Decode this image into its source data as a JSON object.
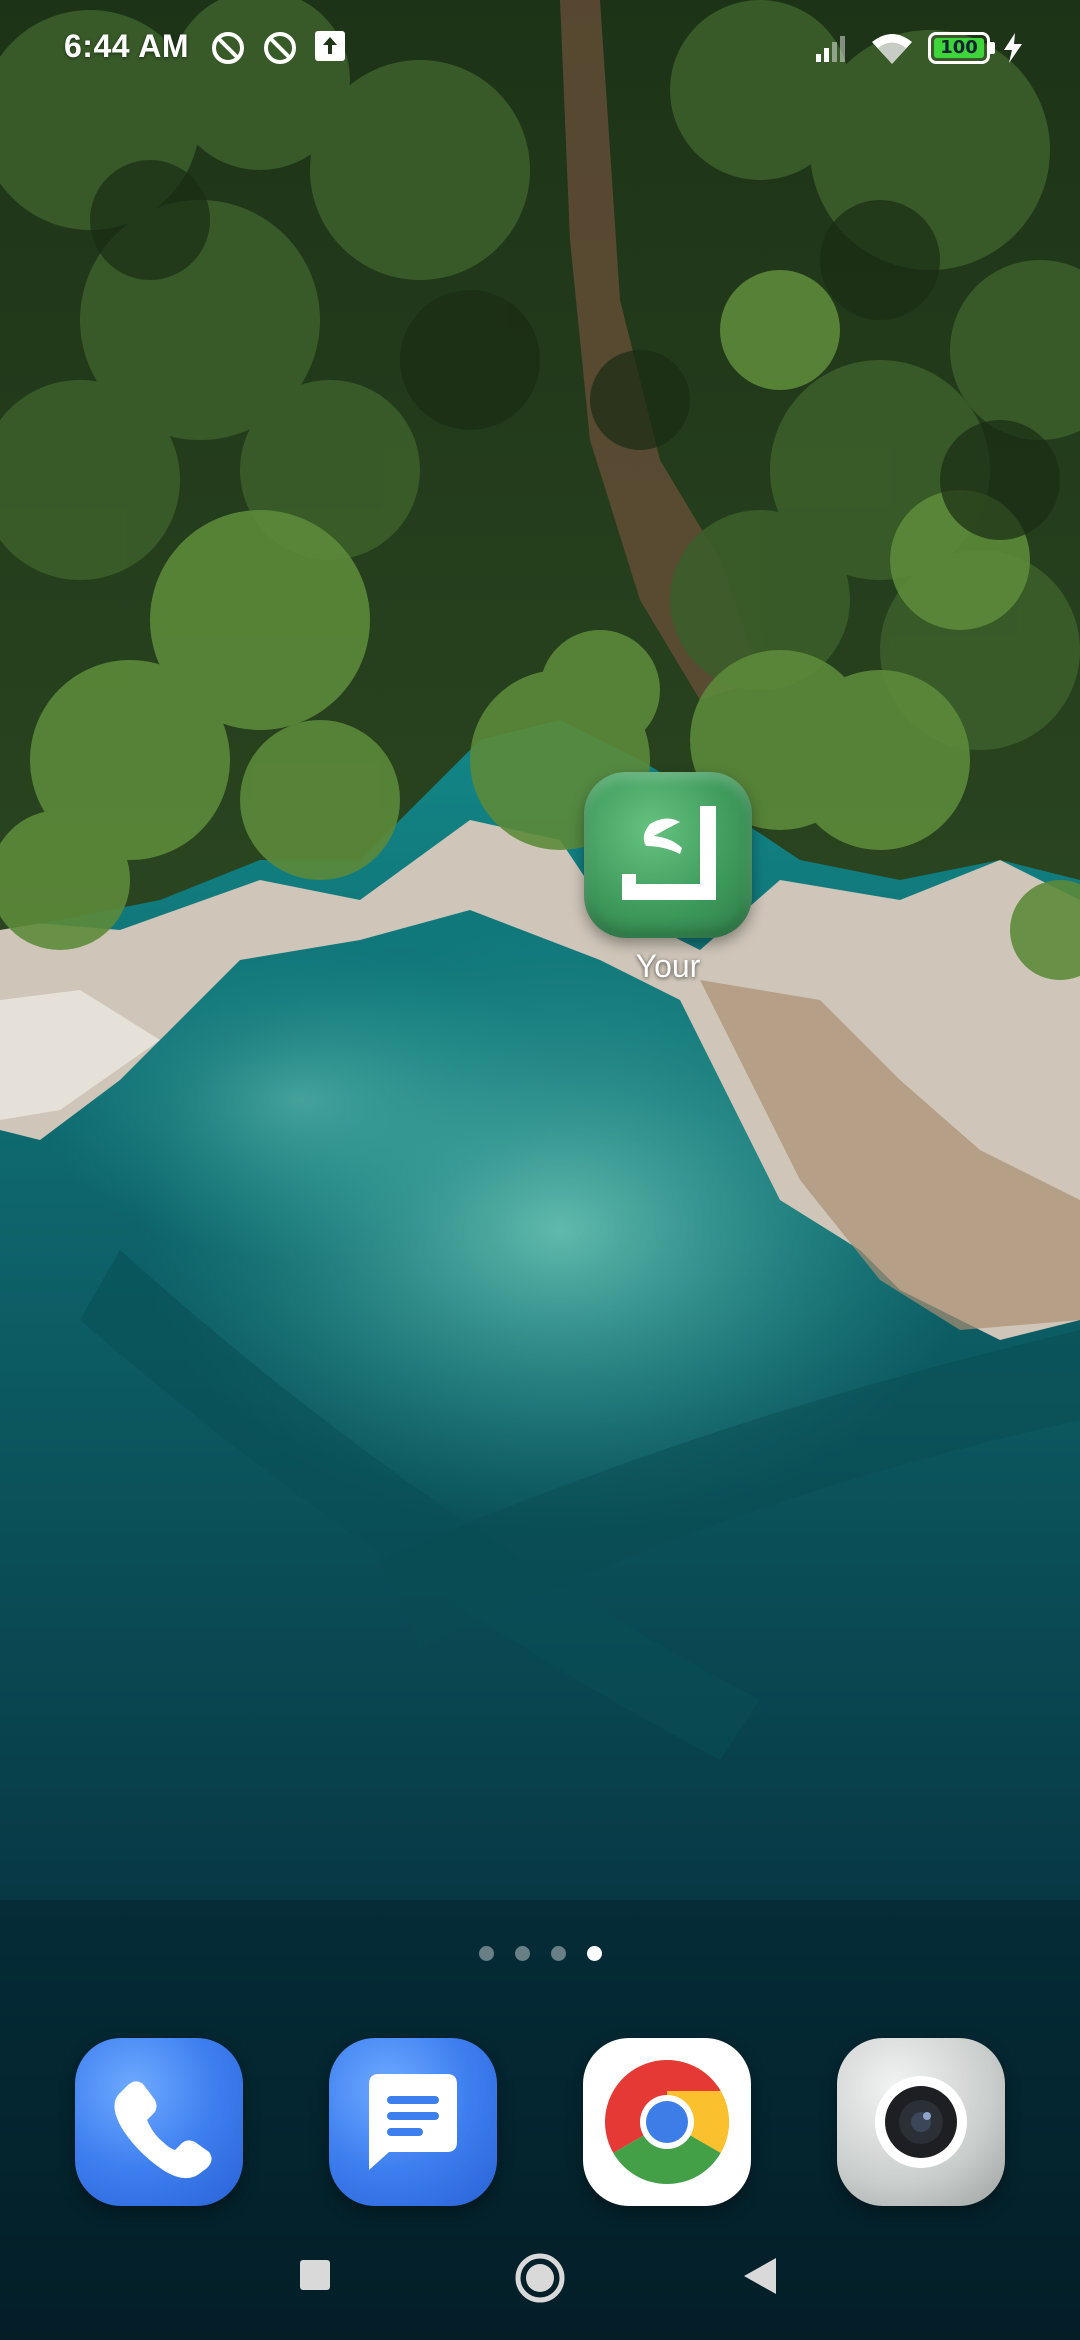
{
  "status_bar": {
    "time": "6:44 AM",
    "left_icons": [
      "do-not-disturb-icon",
      "do-not-disturb-icon",
      "upload-icon"
    ],
    "right_icons": [
      "signal-icon",
      "wifi-icon",
      "battery-icon",
      "charging-bolt-icon"
    ],
    "battery_level": "100"
  },
  "home_screen": {
    "apps": [
      {
        "label": "Your",
        "icon": "arabic-kaf-app-icon",
        "color": "#3e9b5c"
      }
    ],
    "page_count": 4,
    "active_page": 4
  },
  "dock": {
    "apps": [
      {
        "name": "Phone",
        "icon": "phone-icon"
      },
      {
        "name": "Messages",
        "icon": "messages-icon"
      },
      {
        "name": "Chrome",
        "icon": "chrome-icon"
      },
      {
        "name": "Camera",
        "icon": "camera-icon"
      }
    ]
  },
  "nav_bar": {
    "buttons": [
      "recents-square-icon",
      "home-circle-icon",
      "back-triangle-icon"
    ]
  },
  "colors": {
    "accent_green": "#3e9b5c",
    "dock_blue": "#3e7ff0",
    "battery_green": "#3fd43a"
  }
}
